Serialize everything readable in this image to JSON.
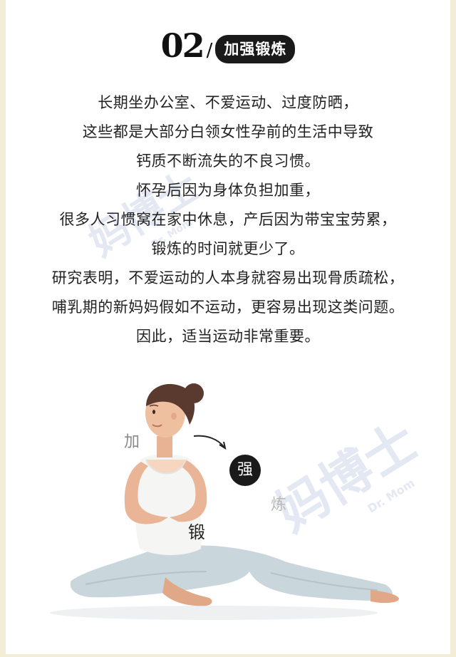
{
  "header": {
    "number": "02",
    "slash": "/",
    "title": "加强锻炼"
  },
  "paragraph_lines": [
    "长期坐办公室、不爱运动、过度防晒，",
    "这些都是大部分白领女性孕前的生活中导致",
    "钙质不断流失的不良习惯。",
    "怀孕后因为身体负担加重，",
    "很多人习惯窝在家中休息，产后因为带宝宝劳累，",
    "锻炼的时间就更少了。",
    "研究表明，不爱运动的人本身就容易出现骨质疏松，",
    "哺乳期的新妈妈假如不运动，更容易出现这类问题。",
    "因此，适当运动非常重要。"
  ],
  "watermark": {
    "cn": "妈博士",
    "en": "Dr. Mom"
  },
  "illustration": {
    "label_jia": "加",
    "label_qiang": "强",
    "label_duan": "锻",
    "label_lian": "炼"
  }
}
